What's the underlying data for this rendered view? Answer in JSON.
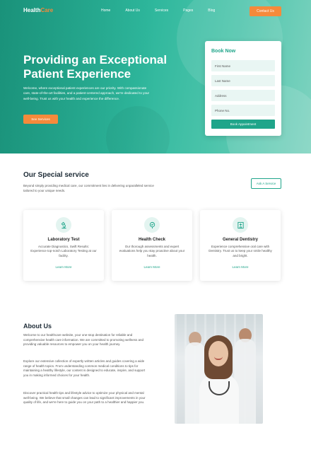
{
  "nav": {
    "logo_part1": "Health",
    "logo_part2": "Care",
    "items": [
      "Home",
      "About Us",
      "Services",
      "Pages",
      "Blog"
    ],
    "contact_label": "Contact Us"
  },
  "hero": {
    "title": "Providing an Exceptional Patient Experience",
    "text": "Welcome, where exceptional patient experiences are our priority. With compassionate care, state-of-the-art facilities, and a patient-centered approach, we're dedicated to your well-being. Trust us with your health and experience the difference.",
    "button_label": "See Services"
  },
  "booking": {
    "title": "Book Now",
    "first_name": "First Name",
    "last_name": "Last Name",
    "address": "Address",
    "phone": "Phone No.",
    "submit_label": "Book Appointment"
  },
  "services": {
    "title": "Our Special service",
    "subtitle": "Beyond simply providing medical care, our commitment lies in delivering unparalleled service tailored to your unique needs.",
    "ask_label": "Ask A Service",
    "cards": [
      {
        "title": "Laboratory Test",
        "desc": "Accurate Diagnostics, Swift Results: Experience top-notch Laboratory Testing at our facility.",
        "link": "Learn More",
        "icon": "microscope-icon"
      },
      {
        "title": "Health Check",
        "desc": "Our thorough assessments and expert evaluations help you stay proactive about your health.",
        "link": "Learn More",
        "icon": "heart-check-icon"
      },
      {
        "title": "General Dentistry",
        "desc": "Experience comprehensive oral care with Dentistry. Trust us to keep your smile healthy and bright.",
        "link": "Learn More",
        "icon": "dental-clinic-icon"
      }
    ]
  },
  "about": {
    "title": "About Us",
    "p1": "Welcome to our healthcare website, your one-stop destination for reliable and comprehensive health care information. We are committed to promoting wellness and providing valuable resources to empower you on your health journey.",
    "p2": "Explore our extensive collection of expertly written articles and guides covering a wide range of health topics. From understanding common medical conditions to tips for maintaining a healthy lifestyle, our content is designed to educate, inspire, and support you in making informed choices for your health.",
    "p3": "Discover practical health tips and lifestyle advice to optimize your physical and mental well-being. We believe that small changes can lead to significant improvements in your quality of life, and we're here to guide you on your path to a healthier and happier you."
  },
  "colors": {
    "brand": "#1fa58a",
    "accent": "#f58a3b"
  }
}
